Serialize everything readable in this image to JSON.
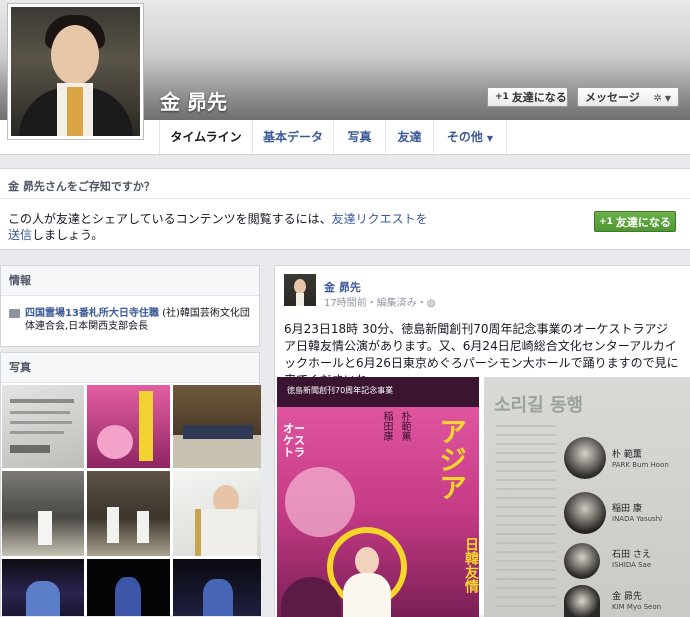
{
  "profile": {
    "name": "金 昴先",
    "add_friend_label": "友達になる",
    "message_label": "メッセージ"
  },
  "tabs": [
    {
      "label": "タイムライン"
    },
    {
      "label": "基本データ"
    },
    {
      "label": "写真"
    },
    {
      "label": "友達"
    },
    {
      "label": "その他"
    }
  ],
  "know_box": {
    "heading": "金 昴先さんをご存知ですか？",
    "text_before": "この人が友達とシェアしているコンテンツを閲覧するには、",
    "link": "友達リクエストを送信",
    "text_after": "しましょう。",
    "button_label": "友達になる"
  },
  "info": {
    "heading": "情報",
    "link_text": "四国霊場13番札所大日寺住職",
    "rest_text": " (社)韓国芸術文化団体連合会,日本関西支部会長"
  },
  "photos": {
    "heading": "写真"
  },
  "post": {
    "author": "金 昴先",
    "meta": "17時間前・編集済み・",
    "text": "6月23日18時 30分、徳島新聞創刊70周年記念事業のオーケストラアジア日韓友情公演があります。又、6月24日尼崎総合文化センターアルカイックホールと6月26日東京めぐろパーシモン大ホールで踊りますので見に来てくださいね。"
  },
  "poster_left": {
    "caption": "徳島新聞創刊70周年記念事業",
    "title": "アジア",
    "subtitle": "日韓友情",
    "names": [
      "朴範薫",
      "稲田康"
    ],
    "side_text": "オーケストラ"
  },
  "poster_right": {
    "title": "소리길 동행",
    "rows": [
      {
        "name": "朴 範薫",
        "roman": "PARK Bum Hoon"
      },
      {
        "name": "稲田 康",
        "roman": "INADA Yasushi"
      },
      {
        "name": "石田 さえ",
        "roman": "ISHIDA Sae"
      },
      {
        "name": "金 昴先",
        "roman": "KIM Myo Seon"
      }
    ]
  },
  "colors": {
    "link": "#3b5998",
    "button_green": "#4f9833",
    "page_bg": "#e9eaed"
  }
}
